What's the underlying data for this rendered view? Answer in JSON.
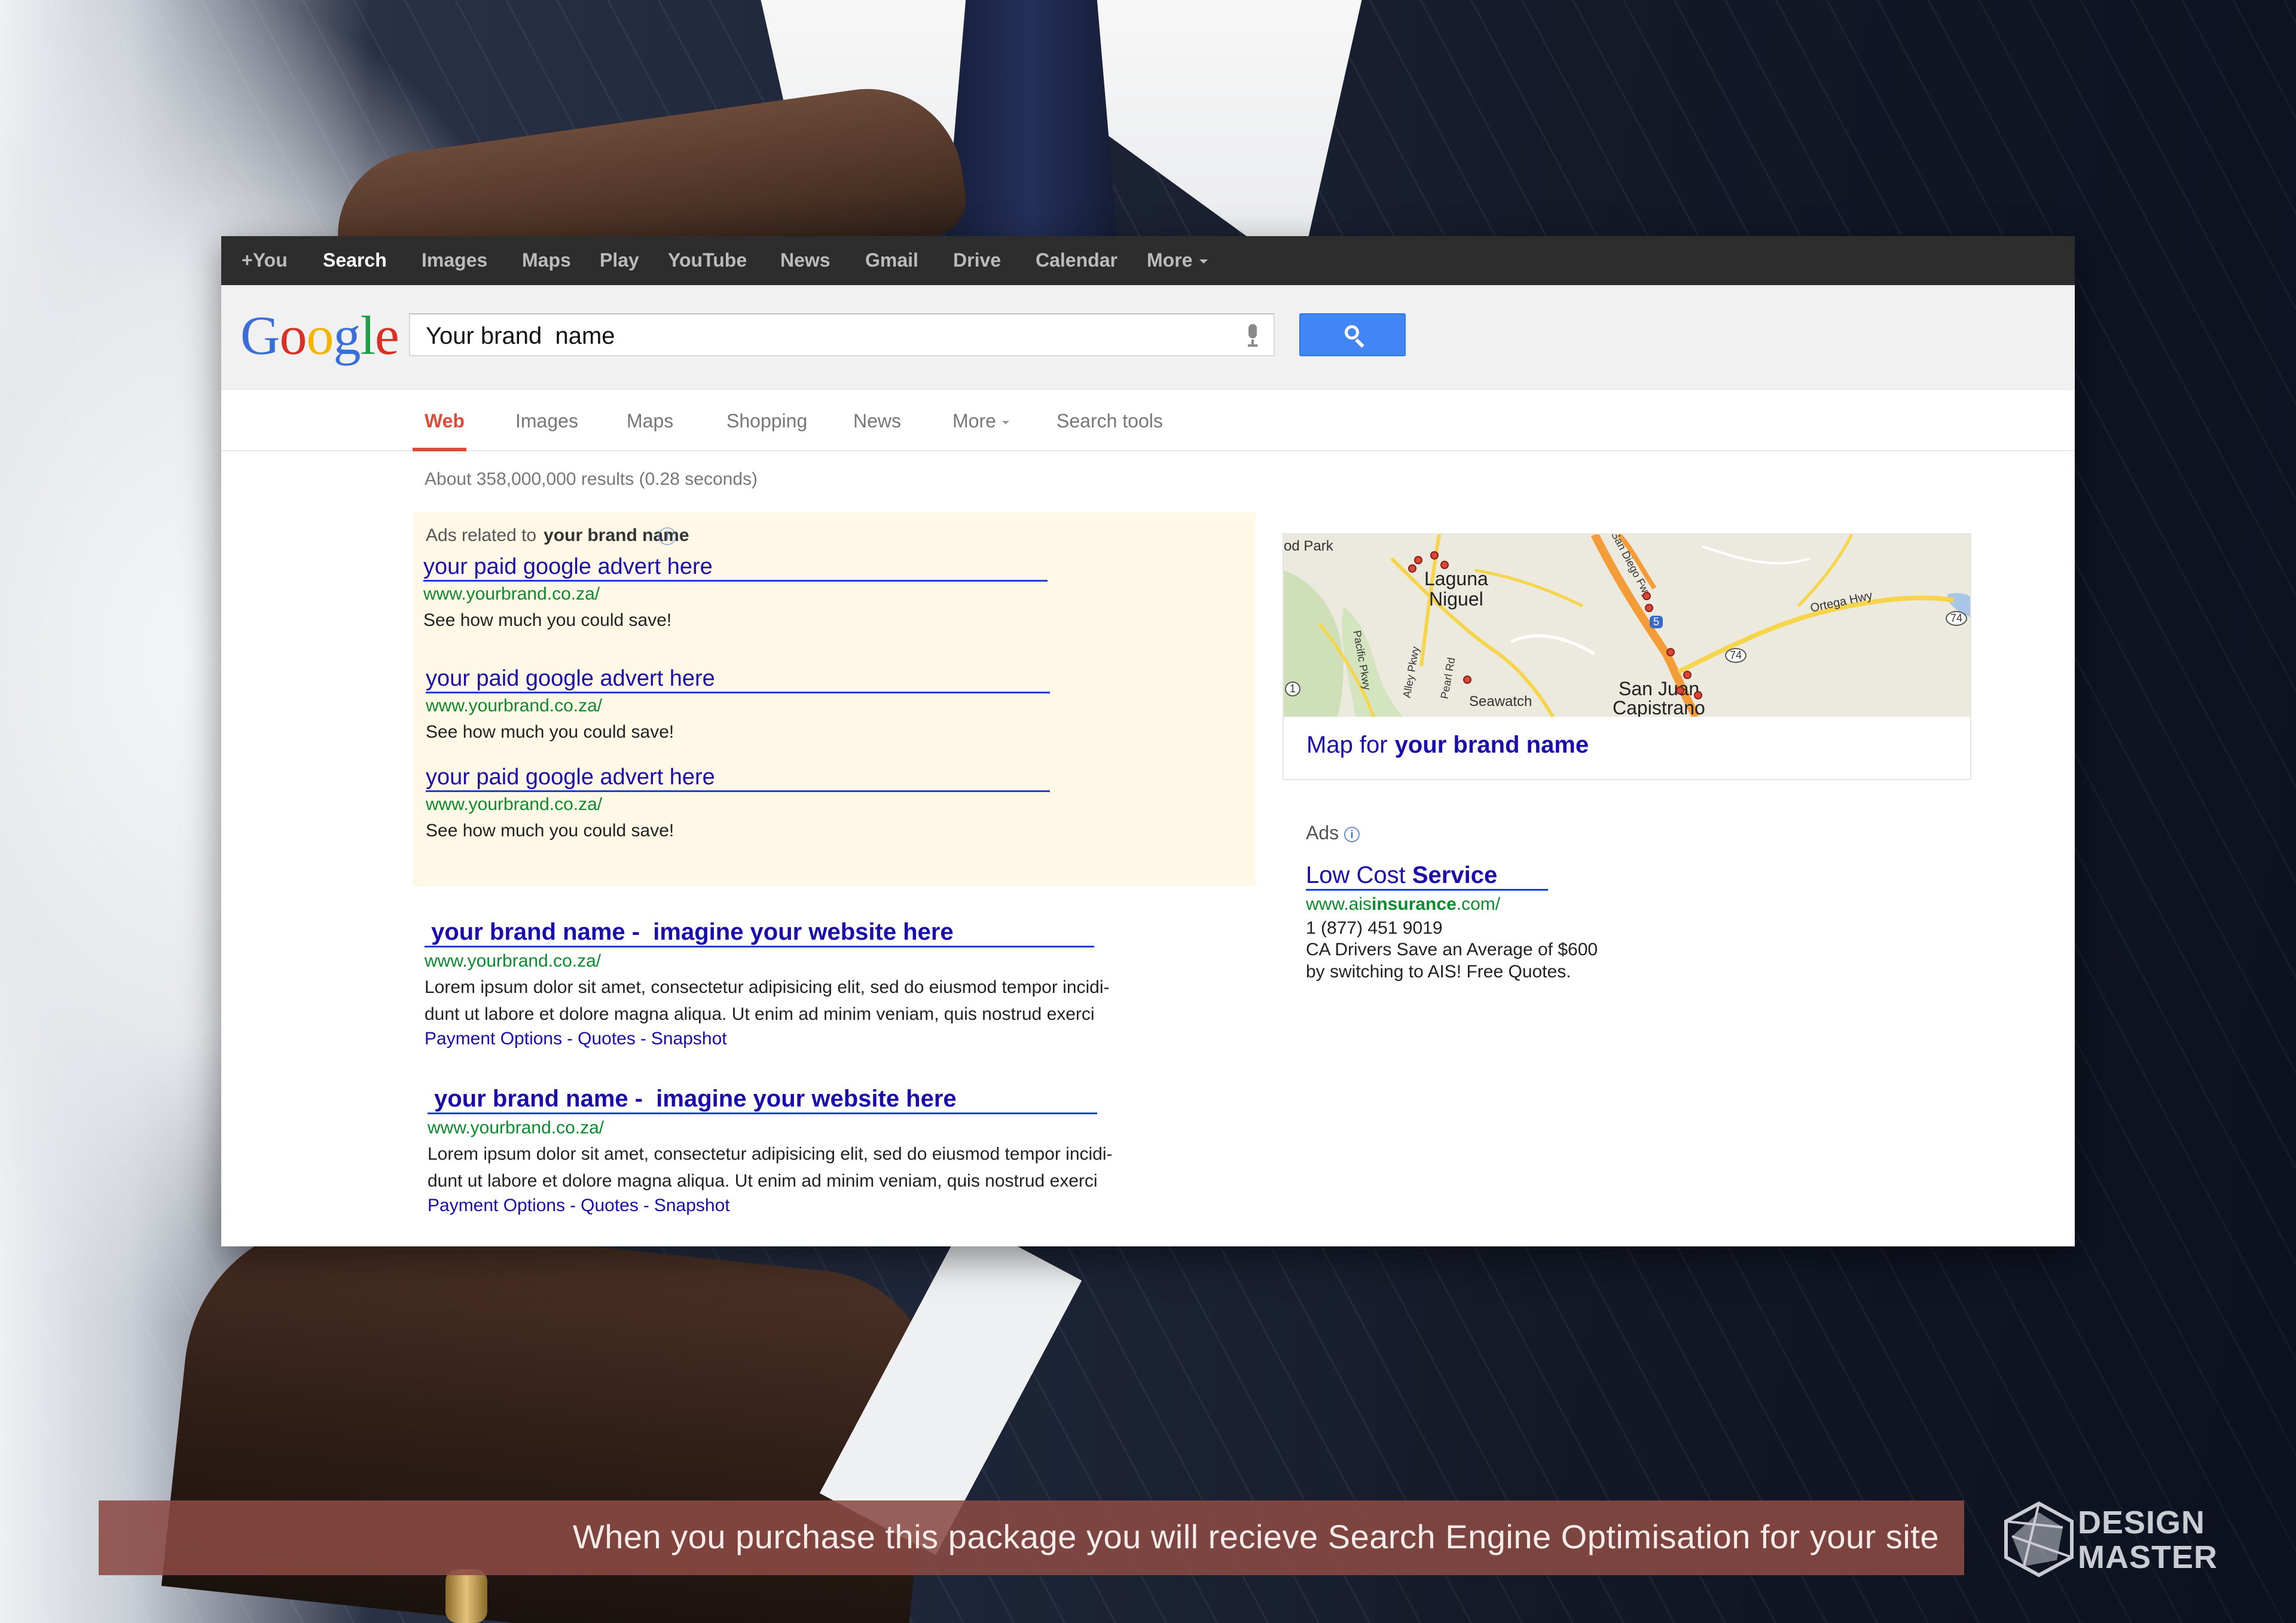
{
  "topbar": {
    "items": [
      "+You",
      "Search",
      "Images",
      "Maps",
      "Play",
      "YouTube",
      "News",
      "Gmail",
      "Drive",
      "Calendar",
      "More"
    ]
  },
  "search": {
    "logo": "Google",
    "query": "Your brand  name"
  },
  "tabs": [
    "Web",
    "Images",
    "Maps",
    "Shopping",
    "News",
    "More",
    "Search tools"
  ],
  "stats": "About 358,000,000 results (0.28 seconds)",
  "ads": {
    "heading_prefix": "Ads related to",
    "heading_term": "your brand name",
    "items": [
      {
        "title": "your paid google advert here",
        "url": "www.yourbrand.co.za/",
        "desc": "See how much you could save!"
      },
      {
        "title": "your paid google advert here",
        "url": "www.yourbrand.co.za/",
        "desc": "See how much you could save!"
      },
      {
        "title": "your paid google advert here",
        "url": "www.yourbrand.co.za/",
        "desc": "See how much you could save!"
      }
    ]
  },
  "results": [
    {
      "title": " your brand name -  imagine your website here",
      "url": "www.yourbrand.co.za/",
      "line1": "Lorem ipsum dolor sit amet, consectetur adipisicing elit, sed do eiusmod tempor incidi-",
      "line2": "dunt ut labore et dolore magna aliqua. Ut enim ad minim veniam, quis nostrud exerci",
      "links": [
        "Payment Options",
        "Quotes",
        "Snapshot"
      ]
    },
    {
      "title": " your brand name -  imagine your website here",
      "url": "www.yourbrand.co.za/",
      "line1": "Lorem ipsum dolor sit amet, consectetur adipisicing elit, sed do eiusmod tempor incidi-",
      "line2": "dunt ut labore et dolore magna aliqua. Ut enim ad minim veniam, quis nostrud exerci",
      "links": [
        "Payment Options",
        "Quotes",
        "Snapshot"
      ]
    }
  ],
  "map": {
    "labels": [
      "od Park",
      "Laguna",
      "Niguel",
      "Seawatch",
      "San Juan",
      "Capistrano",
      "Ortega Hwy",
      "San Diego Fwy",
      "Pacific Pkwy",
      "Alley Pkwy",
      "Pearl Rd",
      "5",
      "74",
      "74",
      "1"
    ],
    "caption_prefix": "Map for",
    "caption_term": "your brand name"
  },
  "side_ad": {
    "heading": "Ads",
    "title_plain": "Low Cost ",
    "title_bold": "Service",
    "url_pre": "www.ais",
    "url_bold": "insurance",
    "url_post": ".com/",
    "phone": "1 (877) 451 9019",
    "desc1": "CA Drivers Save an Average of $600",
    "desc2": "by switching to AIS! Free Quotes."
  },
  "banner": "When you purchase this package you will recieve Search Engine Optimisation for your site",
  "brand": {
    "line1": "DESIGN",
    "line2": "MASTER"
  },
  "colors": {
    "link": "#1a0dab",
    "url": "#0b8a2e",
    "active_tab": "#dd4b39",
    "ads_bg": "#fff8e7",
    "search_button": "#4285f4",
    "banner": "#8b4a43"
  }
}
